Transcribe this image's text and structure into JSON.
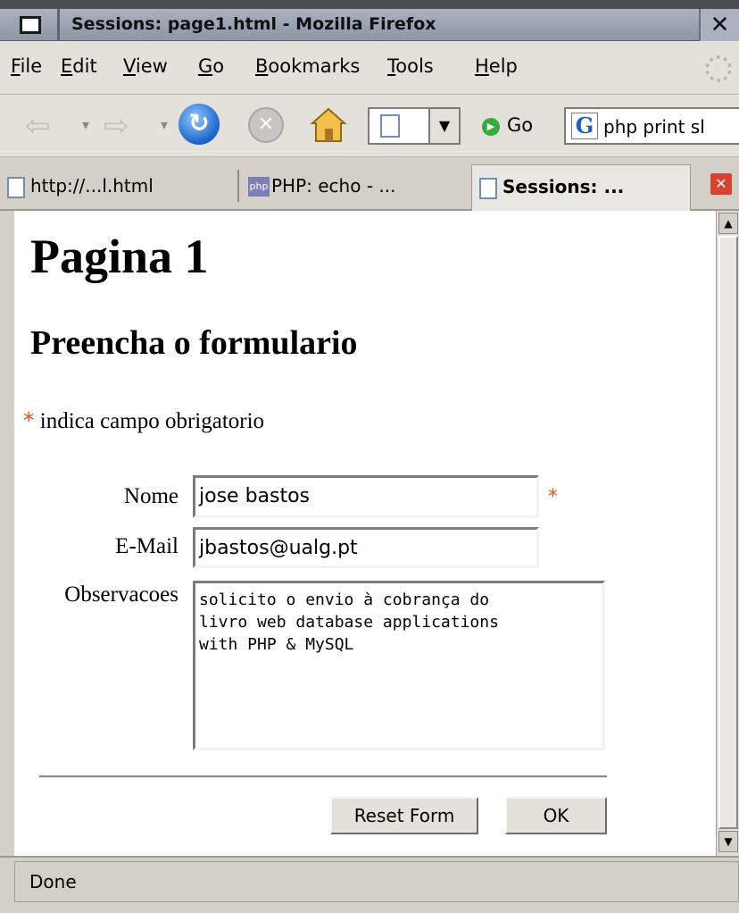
{
  "window": {
    "title": "Sessions: page1.html - Mozilla Firefox",
    "close_glyph": "✕"
  },
  "menu": {
    "items": [
      {
        "accel": "F",
        "rest": "ile"
      },
      {
        "accel": "E",
        "rest": "dit"
      },
      {
        "accel": "V",
        "rest": "iew"
      },
      {
        "accel": "G",
        "rest": "o"
      },
      {
        "accel": "B",
        "rest": "ookmarks"
      },
      {
        "accel": "T",
        "rest": "ools"
      },
      {
        "accel": "H",
        "rest": "elp"
      }
    ]
  },
  "toolbar": {
    "go_label": "Go",
    "search_query": "php print sl"
  },
  "tabs": [
    {
      "label": "http://...l.html",
      "icon": "page-icon",
      "active": false
    },
    {
      "label": "PHP: echo - ...",
      "icon": "php-icon",
      "active": false
    },
    {
      "label": "Sessions: ...",
      "icon": "page-icon",
      "active": true
    }
  ],
  "page": {
    "heading": "Pagina 1",
    "subheading": "Preencha o formulario",
    "required_marker": "*",
    "required_note": "indica campo obrigatorio",
    "form": {
      "nome_label": "Nome",
      "nome_value": "jose bastos",
      "email_label": "E-Mail",
      "email_value": "jbastos@ualg.pt",
      "obs_label": "Observacoes",
      "obs_lines": [
        "solicito o envio à cobrança do",
        "livro web database applications",
        "with PHP & MySQL"
      ],
      "reset_label": "Reset Form",
      "ok_label": "OK"
    }
  },
  "status": {
    "text": "Done"
  },
  "colors": {
    "required": "#e8541d"
  }
}
